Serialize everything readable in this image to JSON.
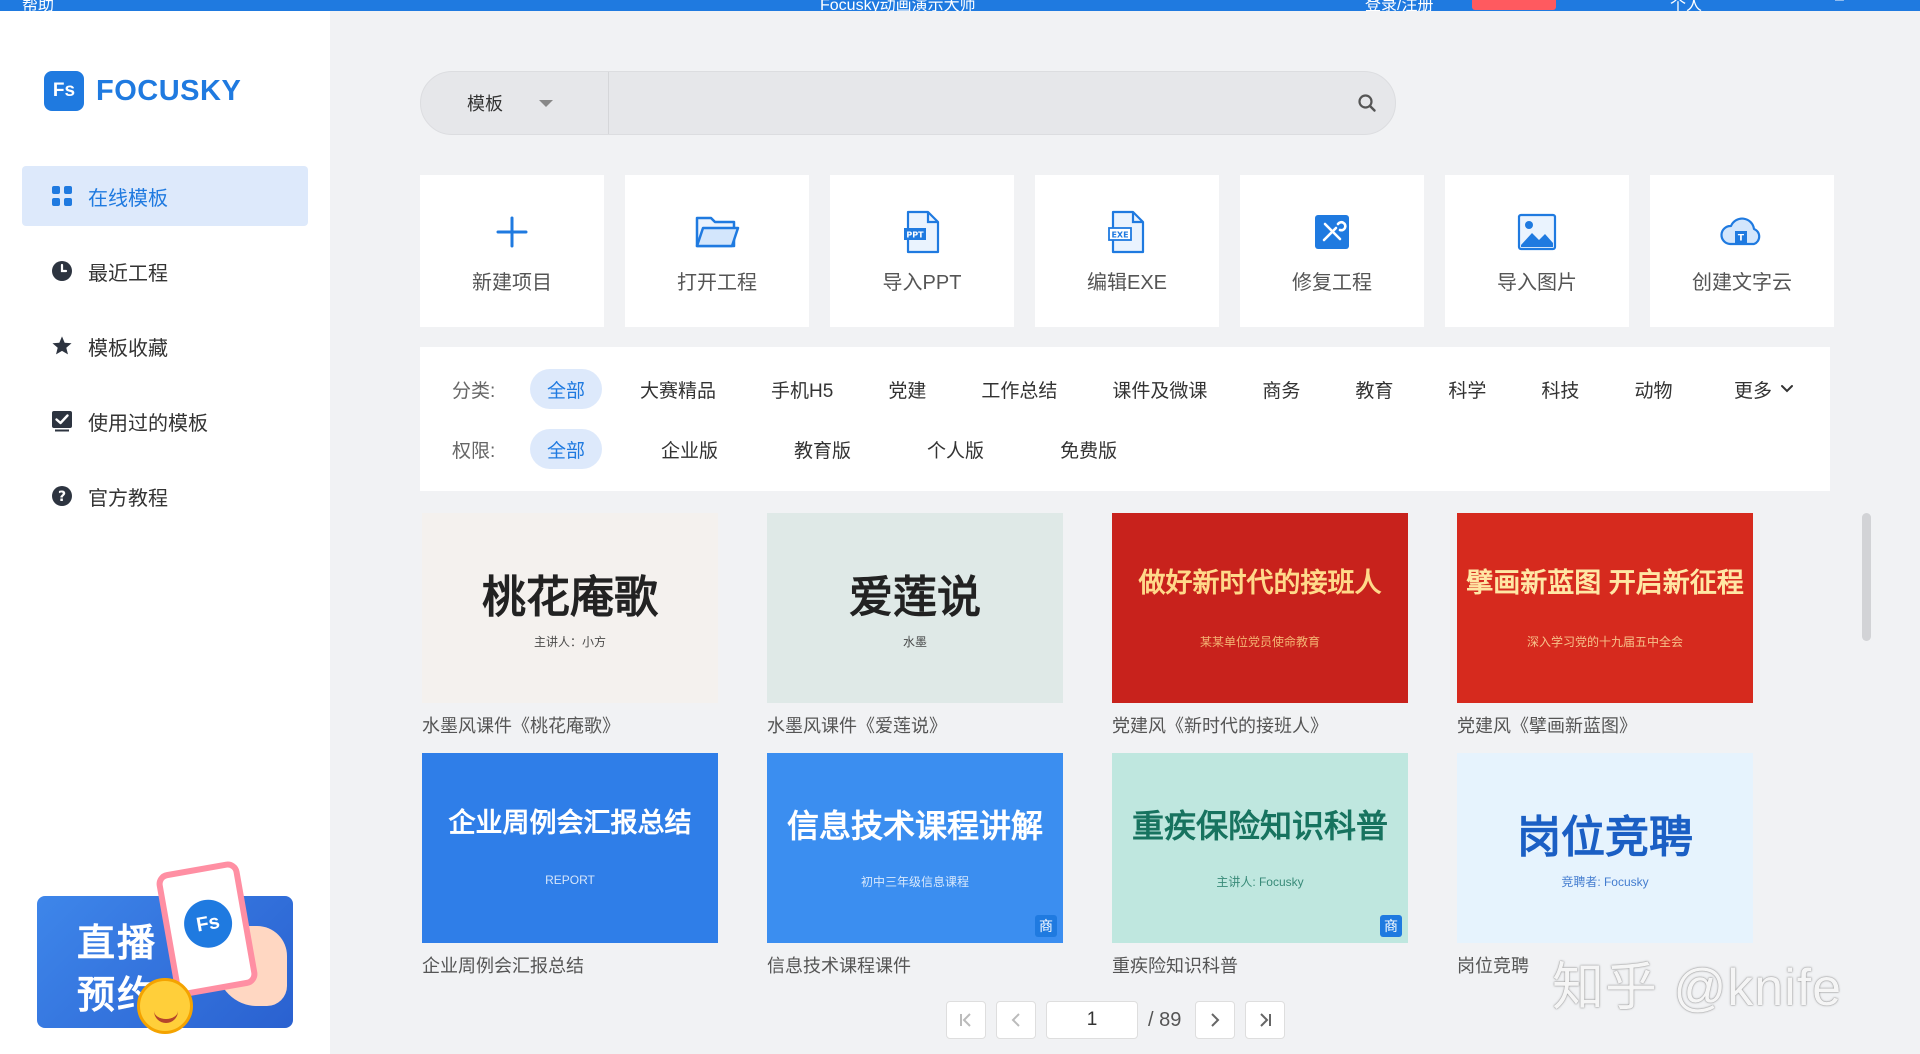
{
  "topbar": {
    "help": "帮助",
    "title": "Focusky动画演示大师",
    "login": "登录/注册",
    "user": "个人"
  },
  "sidebar": {
    "logo_badge": "Fs",
    "logo_text": "FOCUSKY",
    "items": [
      {
        "label": "在线模板",
        "icon": "grid-icon",
        "active": true
      },
      {
        "label": "最近工程",
        "icon": "clock-icon"
      },
      {
        "label": "模板收藏",
        "icon": "star-icon"
      },
      {
        "label": "使用过的模板",
        "icon": "check-box-icon"
      },
      {
        "label": "官方教程",
        "icon": "help-circle-icon"
      }
    ],
    "live_banner": {
      "line1": "直播",
      "line2": "预约",
      "phone_badge": "Fs"
    }
  },
  "search": {
    "scope": "模板",
    "placeholder": ""
  },
  "actions": [
    {
      "label": "新建项目",
      "icon": "plus-icon"
    },
    {
      "label": "打开工程",
      "icon": "folder-icon"
    },
    {
      "label": "导入PPT",
      "icon": "ppt-file-icon"
    },
    {
      "label": "编辑EXE",
      "icon": "exe-file-icon"
    },
    {
      "label": "修复工程",
      "icon": "repair-icon"
    },
    {
      "label": "导入图片",
      "icon": "image-icon"
    },
    {
      "label": "创建文字云",
      "icon": "cloud-icon"
    }
  ],
  "filters": {
    "category_label": "分类:",
    "categories": [
      "全部",
      "大赛精品",
      "手机H5",
      "党建",
      "工作总结",
      "课件及微课",
      "商务",
      "教育",
      "科学",
      "科技",
      "动物"
    ],
    "more": "更多",
    "permission_label": "权限:",
    "permissions": [
      "全部",
      "企业版",
      "教育版",
      "个人版",
      "免费版"
    ]
  },
  "templates": [
    {
      "title": "水墨风课件《桃花庵歌》",
      "thumb_text": "桃花庵歌",
      "thumb_sub": "主讲人：小方",
      "bg": "#f4f1ee",
      "fg": "#222222"
    },
    {
      "title": "水墨风课件《爱莲说》",
      "thumb_text": "爱莲说",
      "thumb_sub": "水墨",
      "bg": "#dfe9e7",
      "fg": "#222222"
    },
    {
      "title": "党建风《新时代的接班人》",
      "thumb_text": "做好新时代的接班人",
      "thumb_sub": "某某单位党员使命教育",
      "bg": "#c8221c",
      "fg": "#ffd98a"
    },
    {
      "title": "党建风《擘画新蓝图》",
      "thumb_text": "擘画新蓝图 开启新征程",
      "thumb_sub": "深入学习党的十九届五中全会",
      "bg": "#d62a1e",
      "fg": "#ffe7a5"
    },
    {
      "title": "企业周例会汇报总结",
      "thumb_text": "企业周例会汇报总结",
      "thumb_sub": "REPORT",
      "bg": "#2f7ee8",
      "fg": "#ffffff"
    },
    {
      "title": "信息技术课程课件",
      "thumb_text": "信息技术课程讲解",
      "thumb_sub": "初中三年级信息课程",
      "bg": "#3b8ef0",
      "fg": "#ffffff",
      "badge": "商"
    },
    {
      "title": "重疾险知识科普",
      "thumb_text": "重疾保险知识科普",
      "thumb_sub": "主讲人: Focusky",
      "bg": "#bfe7df",
      "fg": "#17735f",
      "badge": "商"
    },
    {
      "title": "岗位竞聘",
      "thumb_text": "岗位竞聘",
      "thumb_sub": "竞聘者: Focusky",
      "bg": "#e6f3fd",
      "fg": "#1b5fc4"
    }
  ],
  "pager": {
    "current": "1",
    "total": "/ 89"
  },
  "watermark": "知乎 @knife",
  "colors": {
    "brand": "#1f7ae0",
    "active_bg": "#dde9fb",
    "page_bg": "#f1f2f4"
  }
}
